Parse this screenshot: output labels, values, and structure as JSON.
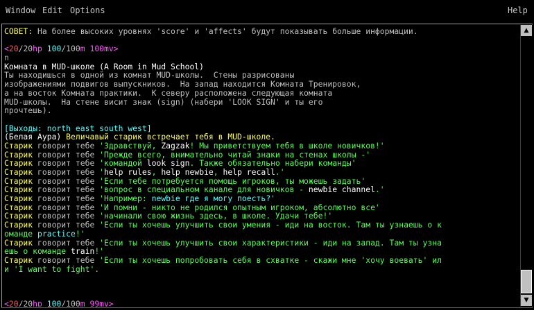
{
  "menubar": {
    "window": "Window",
    "edit": "Edit",
    "options": "Options",
    "help": "Help"
  },
  "colors": {
    "yellow": "#ffff55",
    "green": "#55ff55",
    "cyan": "#55ffff",
    "red": "#ff5555",
    "white": "#ffffff",
    "grey": "#c0c0c0",
    "darkgrey": "#a8a8a8",
    "magenta": "#ff55ff",
    "dkred": "#cc3333"
  },
  "terminal": {
    "lines": [
      [
        {
          "t": "СОВЕТ:",
          "c": "yellow"
        },
        {
          "t": " На более высоких уровнях 'score' и 'affects' будут показывать больше информации.",
          "c": "grey"
        }
      ],
      [],
      [
        {
          "t": "<",
          "c": "magenta"
        },
        {
          "t": "20",
          "c": "red"
        },
        {
          "t": "/",
          "c": "grey"
        },
        {
          "t": "20",
          "c": "grey"
        },
        {
          "t": "hp ",
          "c": "magenta"
        },
        {
          "t": "100",
          "c": "cyan"
        },
        {
          "t": "/",
          "c": "grey"
        },
        {
          "t": "100",
          "c": "grey"
        },
        {
          "t": "m ",
          "c": "magenta"
        },
        {
          "t": "100mv",
          "c": "magenta"
        },
        {
          "t": ">",
          "c": "magenta"
        }
      ],
      [
        {
          "t": "n",
          "c": "darkgrey"
        }
      ],
      [
        {
          "t": "Комната в MUD-школе (A Room in Mud School)",
          "c": "white"
        }
      ],
      [
        {
          "t": "Ты находишься в одной из комнат MUD-школы.  Стены разрисованы",
          "c": "grey"
        }
      ],
      [
        {
          "t": "изображениями подвигов выпускников.  На запад находится Комната Тренировок,",
          "c": "grey"
        }
      ],
      [
        {
          "t": "а на восток Комната практики.  К северу расположена следующая комната",
          "c": "grey"
        }
      ],
      [
        {
          "t": "MUD-школы.  На стене висит знак (sign) (набери 'LOOK SIGN' и ты его",
          "c": "grey"
        }
      ],
      [
        {
          "t": "прочтешь).",
          "c": "grey"
        }
      ],
      [],
      [
        {
          "t": "[Выходы: north east south west]",
          "c": "cyan"
        }
      ],
      [
        {
          "t": "(Белая Аура) ",
          "c": "white"
        },
        {
          "t": "Величавый старик встречает тебя в MUD-школе.",
          "c": "yellow"
        }
      ],
      [
        {
          "t": "Старик",
          "c": "yellow"
        },
        {
          "t": " говорит тебе ",
          "c": "grey"
        },
        {
          "t": "'Здравствуй, ",
          "c": "green"
        },
        {
          "t": "Zagzak",
          "c": "white"
        },
        {
          "t": "! Мы приветствуем тебя в школе новичков!'",
          "c": "green"
        }
      ],
      [
        {
          "t": "Старик",
          "c": "yellow"
        },
        {
          "t": " говорит тебе ",
          "c": "grey"
        },
        {
          "t": "'Прежде всего, внимательно читай знаки на стенах школы -'",
          "c": "green"
        }
      ],
      [
        {
          "t": "Старик",
          "c": "yellow"
        },
        {
          "t": " говорит тебе ",
          "c": "grey"
        },
        {
          "t": "'командой ",
          "c": "green"
        },
        {
          "t": "look sign",
          "c": "white"
        },
        {
          "t": ". Также обязательно набери команды'",
          "c": "green"
        }
      ],
      [
        {
          "t": "Старик",
          "c": "yellow"
        },
        {
          "t": " говорит тебе ",
          "c": "grey"
        },
        {
          "t": "'",
          "c": "green"
        },
        {
          "t": "help rules",
          "c": "white"
        },
        {
          "t": ", ",
          "c": "green"
        },
        {
          "t": "help newbie",
          "c": "white"
        },
        {
          "t": ", ",
          "c": "green"
        },
        {
          "t": "help recall",
          "c": "white"
        },
        {
          "t": ".'",
          "c": "green"
        }
      ],
      [
        {
          "t": "Старик",
          "c": "yellow"
        },
        {
          "t": " говорит тебе ",
          "c": "grey"
        },
        {
          "t": "'Если тебе потребуется помощь игроков, ты можешь задать'",
          "c": "green"
        }
      ],
      [
        {
          "t": "Старик",
          "c": "yellow"
        },
        {
          "t": " говорит тебе ",
          "c": "grey"
        },
        {
          "t": "'вопрос в специальном канале для новичков - ",
          "c": "green"
        },
        {
          "t": "newbie channel",
          "c": "white"
        },
        {
          "t": ".'",
          "c": "green"
        }
      ],
      [
        {
          "t": "Старик",
          "c": "yellow"
        },
        {
          "t": " говорит тебе ",
          "c": "grey"
        },
        {
          "t": "'Например: ",
          "c": "green"
        },
        {
          "t": "newbie где я могу поесть?",
          "c": "cyan"
        },
        {
          "t": "'",
          "c": "green"
        }
      ],
      [
        {
          "t": "Старик",
          "c": "yellow"
        },
        {
          "t": " говорит тебе ",
          "c": "grey"
        },
        {
          "t": "'И помни - никто не родился опытным игроком, абсолютно все'",
          "c": "green"
        }
      ],
      [
        {
          "t": "Старик",
          "c": "yellow"
        },
        {
          "t": " говорит тебе ",
          "c": "grey"
        },
        {
          "t": "'начинали свою жизнь здесь, в школе. Удачи тебе!'",
          "c": "green"
        }
      ],
      [
        {
          "t": "Старик",
          "c": "yellow"
        },
        {
          "t": " говорит тебе ",
          "c": "grey"
        },
        {
          "t": "'Если ты хочешь улучшить свои умения - иди на восток. Там ты узнаешь о к",
          "c": "green"
        }
      ],
      [
        {
          "t": "оманде ",
          "c": "green"
        },
        {
          "t": "practice",
          "c": "cyan"
        },
        {
          "t": "!'",
          "c": "green"
        }
      ],
      [
        {
          "t": "Старик",
          "c": "yellow"
        },
        {
          "t": " говорит тебе ",
          "c": "grey"
        },
        {
          "t": "'Если ты хочешь улучшить свои характеристики - иди на запад. Там ты узна",
          "c": "green"
        }
      ],
      [
        {
          "t": "ешь о команде ",
          "c": "green"
        },
        {
          "t": "train",
          "c": "white"
        },
        {
          "t": "!'",
          "c": "green"
        }
      ],
      [
        {
          "t": "Старик",
          "c": "yellow"
        },
        {
          "t": " говорит тебе ",
          "c": "grey"
        },
        {
          "t": "'Если ты хочешь попробовать себя в схватке - скажи мне 'хочу воевать' ил",
          "c": "green"
        }
      ],
      [
        {
          "t": "и 'I want to fight'.",
          "c": "green"
        }
      ],
      [],
      [],
      [],
      [
        {
          "t": "<",
          "c": "magenta"
        },
        {
          "t": "20",
          "c": "red"
        },
        {
          "t": "/",
          "c": "grey"
        },
        {
          "t": "20",
          "c": "grey"
        },
        {
          "t": "hp ",
          "c": "magenta"
        },
        {
          "t": "100",
          "c": "cyan"
        },
        {
          "t": "/",
          "c": "grey"
        },
        {
          "t": "100",
          "c": "grey"
        },
        {
          "t": "m ",
          "c": "magenta"
        },
        {
          "t": "99mv",
          "c": "magenta"
        },
        {
          "t": ">",
          "c": "magenta"
        }
      ]
    ]
  },
  "scrollbar": {
    "up_icon": "triangle-up-icon",
    "down_icon": "triangle-down-icon"
  }
}
